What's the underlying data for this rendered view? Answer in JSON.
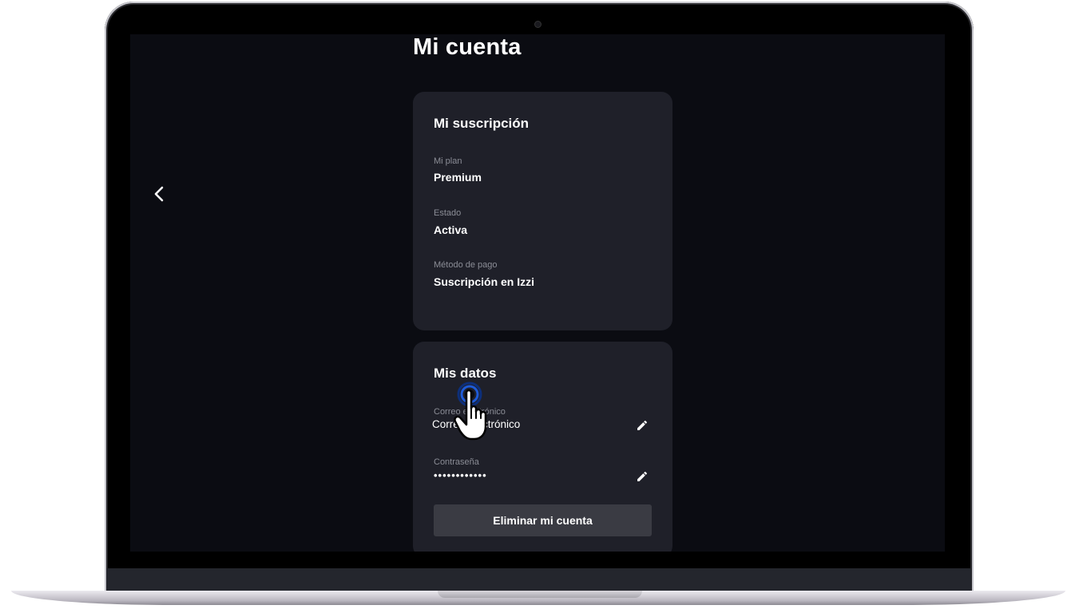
{
  "page": {
    "title": "Mi cuenta"
  },
  "subscription": {
    "title": "Mi suscripción",
    "plan_label": "Mi plan",
    "plan_value": "Premium",
    "status_label": "Estado",
    "status_value": "Activa",
    "payment_label": "Método de pago",
    "payment_value": "Suscripción en Izzi"
  },
  "my_data": {
    "title": "Mis datos",
    "email_label": "Correo electrónico",
    "email_value": "Correo electrónico",
    "password_label": "Contraseña",
    "password_value": "••••••••••••",
    "delete_label": "Eliminar mi cuenta"
  },
  "icons": {
    "back": "chevron-left-icon",
    "edit": "pencil-icon",
    "cursor": "hand-pointer-icon"
  },
  "colors": {
    "screen_bg": "#0b0c12",
    "card_bg": "#1f2029",
    "button_bg": "#3a3b43",
    "cursor_ring": "#1e5bd8"
  }
}
